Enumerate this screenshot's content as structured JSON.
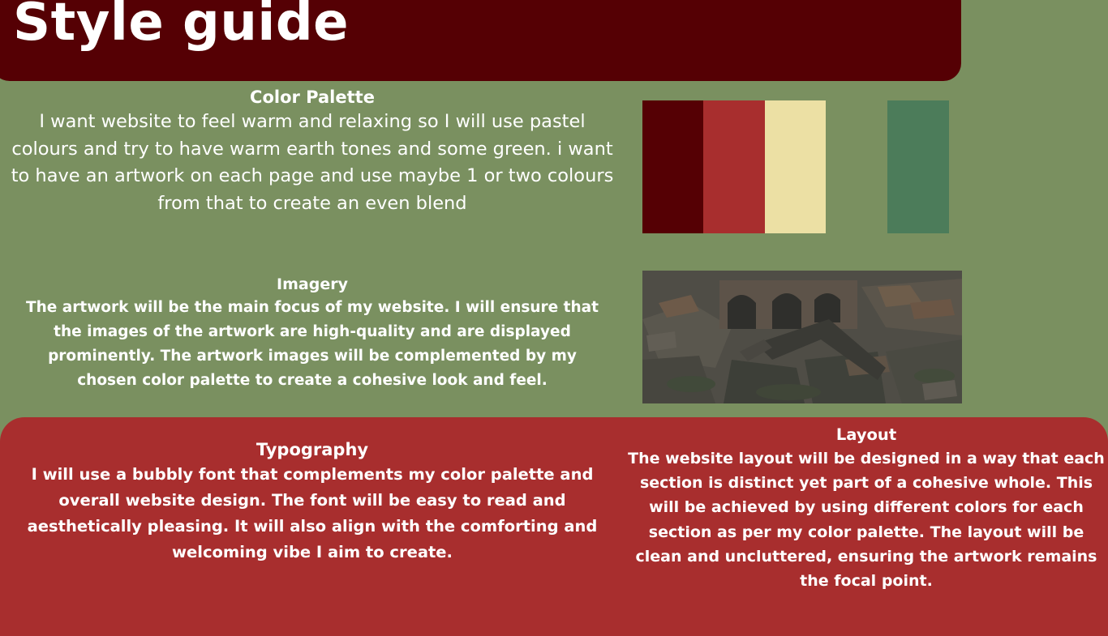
{
  "title": "Style guide",
  "color_palette": {
    "heading": "Color Palette",
    "body": "I want website to feel warm and relaxing so I will use pastel colours and try to have warm earth tones and some green. i want to have an artwork on each page and use maybe 1 or two colours from that to create an even blend",
    "swatches": [
      "#550004",
      "#a82e2e",
      "#ece0a4",
      "#7a9060",
      "#4c7c5a"
    ]
  },
  "imagery": {
    "heading": "Imagery",
    "body": "The artwork will be the main focus of my website. I will ensure that the images of the artwork are high-quality and are displayed prominently. The artwork images will be complemented by my chosen color palette to create a cohesive look and feel."
  },
  "typography": {
    "heading": "Typography",
    "body": "I will use a bubbly font that complements my color palette and overall website design. The font will be easy to read and aesthetically pleasing. It will also align with the comforting and welcoming vibe I aim to create."
  },
  "layout": {
    "heading": "Layout",
    "body": "The website layout will be designed in a way that each section is distinct yet part of a cohesive whole. This will be achieved by using different colors for each section as per my color palette. The layout will be clean and uncluttered, ensuring the artwork remains the focal point."
  },
  "colors": {
    "background": "#7a9060",
    "title_bar": "#550004",
    "panel": "#a82e2e",
    "text": "#ffffff"
  }
}
